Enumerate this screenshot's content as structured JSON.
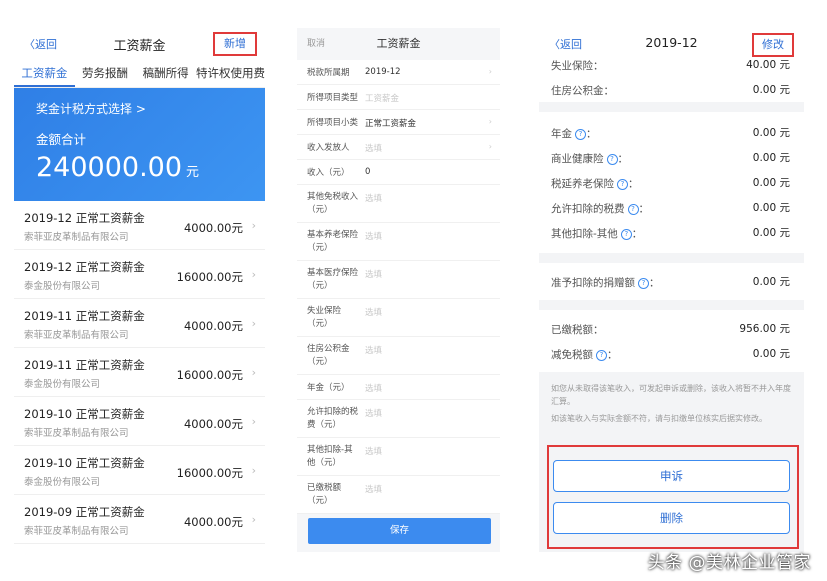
{
  "left": {
    "back": "〈返回",
    "title": "工资薪金",
    "add": "新增",
    "tabs": [
      "工资薪金",
      "劳务报酬",
      "稿酬所得",
      "特许权使用费"
    ],
    "banner": {
      "link": "奖金计税方式选择 >",
      "label": "金额合计",
      "amount": "240000.00",
      "unit": "元"
    },
    "records": [
      {
        "title": "2019-12 正常工资薪金",
        "company": "索菲亚皮革制品有限公司",
        "amount": "4000.00元"
      },
      {
        "title": "2019-12 正常工资薪金",
        "company": "泰金股份有限公司",
        "amount": "16000.00元"
      },
      {
        "title": "2019-11 正常工资薪金",
        "company": "索菲亚皮革制品有限公司",
        "amount": "4000.00元"
      },
      {
        "title": "2019-11 正常工资薪金",
        "company": "泰金股份有限公司",
        "amount": "16000.00元"
      },
      {
        "title": "2019-10 正常工资薪金",
        "company": "索菲亚皮革制品有限公司",
        "amount": "4000.00元"
      },
      {
        "title": "2019-10 正常工资薪金",
        "company": "泰金股份有限公司",
        "amount": "16000.00元"
      },
      {
        "title": "2019-09 正常工资薪金",
        "company": "索菲亚皮革制品有限公司",
        "amount": "4000.00元"
      }
    ]
  },
  "middle": {
    "cancel": "取消",
    "title": "工资薪金",
    "fields": [
      {
        "label": "税款所属期",
        "value": "2019-12",
        "placeholder": false,
        "arrow": true
      },
      {
        "label": "所得项目类型",
        "value": "工资薪金",
        "placeholder": true,
        "arrow": false
      },
      {
        "label": "所得项目小类",
        "value": "正常工资薪金",
        "placeholder": false,
        "arrow": true
      },
      {
        "label": "收入发放人",
        "value": "选填",
        "placeholder": true,
        "arrow": true
      },
      {
        "label": "收入（元）",
        "value": "0",
        "placeholder": false,
        "arrow": false
      },
      {
        "label": "其他免税收入（元）",
        "value": "选填",
        "placeholder": true,
        "arrow": false
      },
      {
        "label": "基本养老保险（元）",
        "value": "选填",
        "placeholder": true,
        "arrow": false
      },
      {
        "label": "基本医疗保险（元）",
        "value": "选填",
        "placeholder": true,
        "arrow": false
      },
      {
        "label": "失业保险（元）",
        "value": "选填",
        "placeholder": true,
        "arrow": false
      },
      {
        "label": "住房公积金（元）",
        "value": "选填",
        "placeholder": true,
        "arrow": false
      },
      {
        "label": "年金（元）",
        "value": "选填",
        "placeholder": true,
        "arrow": false
      },
      {
        "label": "允许扣除的税费（元）",
        "value": "选填",
        "placeholder": true,
        "arrow": false
      },
      {
        "label": "其他扣除-其他（元）",
        "value": "选填",
        "placeholder": true,
        "arrow": false
      },
      {
        "label": "已缴税额（元）",
        "value": "选填",
        "placeholder": true,
        "arrow": false
      }
    ],
    "save": "保存"
  },
  "right": {
    "back": "〈返回",
    "title": "2019-12",
    "modify": "修改",
    "sec1": [
      {
        "label": "失业保险：",
        "value": "40.00 元",
        "help": false
      },
      {
        "label": "住房公积金：",
        "value": "0.00 元",
        "help": false
      }
    ],
    "sec2": [
      {
        "label": "年金",
        "value": "0.00 元",
        "help": true
      },
      {
        "label": "商业健康险",
        "value": "0.00 元",
        "help": true
      },
      {
        "label": "税延养老保险",
        "value": "0.00 元",
        "help": true
      },
      {
        "label": "允许扣除的税费",
        "value": "0.00 元",
        "help": true
      },
      {
        "label": "其他扣除-其他",
        "value": "0.00 元",
        "help": true
      }
    ],
    "sec3": [
      {
        "label": "准予扣除的捐赠额",
        "value": "0.00 元",
        "help": true
      }
    ],
    "sec4": [
      {
        "label": "已缴税额：",
        "value": "956.00 元",
        "help": false
      },
      {
        "label": "减免税额",
        "value": "0.00 元",
        "help": true
      }
    ],
    "note1": "如您从未取得该笔收入，可发起申诉或删除，该收入将暂不并入年度汇算。",
    "note2": "如该笔收入与实际金额不符，请与扣缴单位核实后据实修改。",
    "appeal": "申诉",
    "delete": "删除"
  },
  "watermark": "头条 @美林企业管家"
}
